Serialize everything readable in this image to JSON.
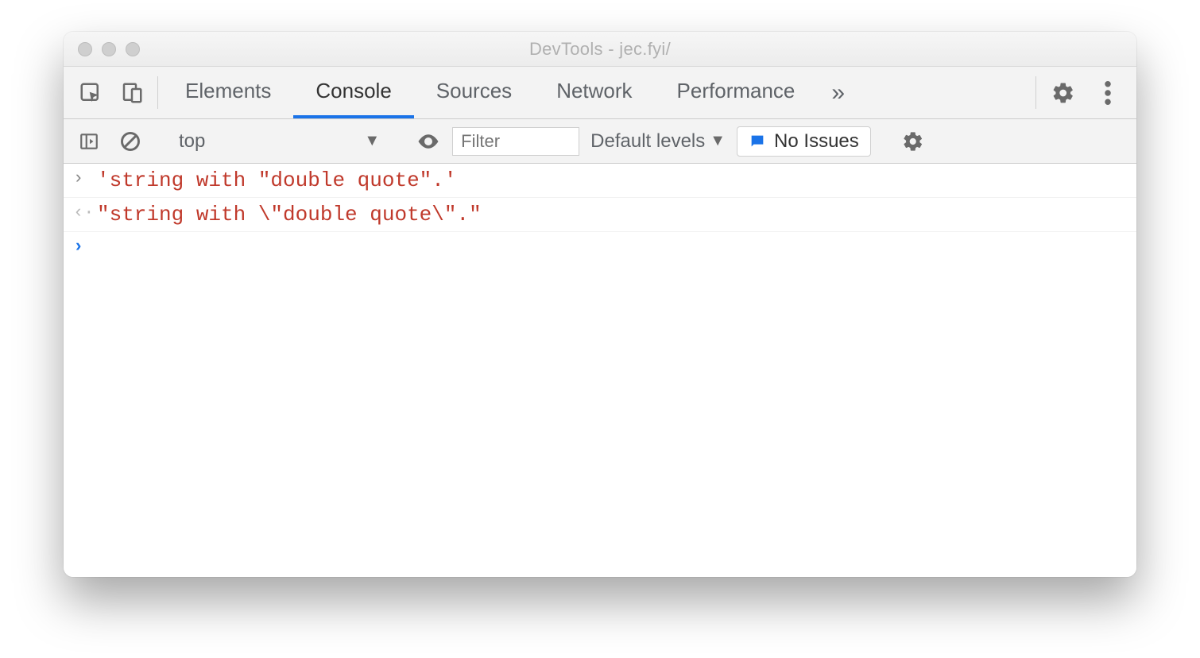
{
  "window": {
    "title": "DevTools - jec.fyi/"
  },
  "tabs": {
    "items": [
      "Elements",
      "Console",
      "Sources",
      "Network",
      "Performance"
    ],
    "active_index": 1,
    "more_glyph": "»"
  },
  "toolbar": {
    "context": "top",
    "filter_placeholder": "Filter",
    "levels_label": "Default levels",
    "issues_label": "No Issues"
  },
  "console": {
    "lines": [
      {
        "kind": "input",
        "text": "'string with \"double quote\".'"
      },
      {
        "kind": "output",
        "text": "\"string with \\\"double quote\\\".\""
      }
    ]
  }
}
